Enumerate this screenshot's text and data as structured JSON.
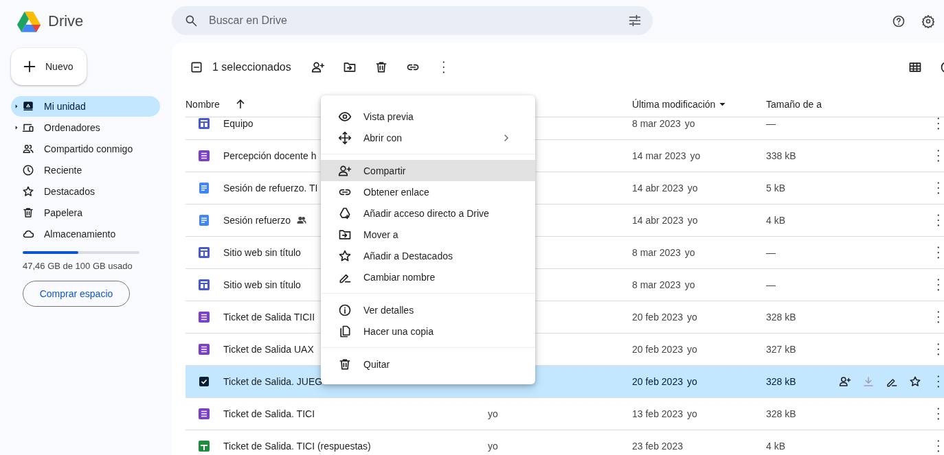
{
  "app": {
    "name": "Drive"
  },
  "search": {
    "placeholder": "Buscar en Drive"
  },
  "new_button": {
    "label": "Nuevo"
  },
  "sidebar": {
    "items": [
      {
        "label": "Mi unidad",
        "selected": true,
        "expandable": true
      },
      {
        "label": "Ordenadores",
        "selected": false,
        "expandable": true
      },
      {
        "label": "Compartido conmigo",
        "selected": false,
        "expandable": false
      },
      {
        "label": "Reciente",
        "selected": false,
        "expandable": false
      },
      {
        "label": "Destacados",
        "selected": false,
        "expandable": false
      },
      {
        "label": "Papelera",
        "selected": false,
        "expandable": false
      },
      {
        "label": "Almacenamiento",
        "selected": false,
        "expandable": false
      }
    ]
  },
  "storage": {
    "level": 0.4746,
    "text": "47,46 GB de 100 GB usado",
    "button": "Comprar espacio"
  },
  "toolbar": {
    "selection": "1 seleccionados"
  },
  "table": {
    "columns": [
      {
        "label": "Nombre",
        "kind": "ascending"
      },
      {
        "label": "Última modificación",
        "kind": "descending"
      },
      {
        "label": "Tamaño de a",
        "kind": "plain"
      }
    ],
    "rows": [
      {
        "kind": "site",
        "name": "Equipo",
        "shared": false,
        "modified": "8 mar 2023",
        "modified_by": "yo",
        "size": "—",
        "selected": false
      },
      {
        "kind": "form",
        "name": "Percepción docente h",
        "modified": "14 mar 2023",
        "modified_by": "yo",
        "size": "338 kB",
        "selected": false
      },
      {
        "kind": "doc",
        "name": "Sesión de refuerzo. TI",
        "modified": "14 abr 2023",
        "modified_by": "yo",
        "size": "5 kB",
        "selected": false
      },
      {
        "kind": "doc",
        "name": "Sesión refuerzo",
        "shared": true,
        "modified": "14 abr 2023",
        "modified_by": "yo",
        "size": "4 kB",
        "selected": false
      },
      {
        "kind": "site",
        "name": "Sitio web sin título",
        "shared": false,
        "modified": "8 mar 2023",
        "modified_by": "yo",
        "size": "—",
        "selected": false
      },
      {
        "kind": "site",
        "name": "Sitio web sin título",
        "shared": false,
        "modified": "8 mar 2023",
        "modified_by": "yo",
        "size": "—",
        "selected": false
      },
      {
        "kind": "form",
        "name": "Ticket de Salida TICII",
        "modified": "20 feb 2023",
        "modified_by": "yo",
        "size": "328 kB",
        "selected": false
      },
      {
        "kind": "form",
        "name": "Ticket de Salida UAX",
        "shared": false,
        "modified": "20 feb 2023",
        "modified_by": "yo",
        "size": "327 kB",
        "selected": false
      },
      {
        "name": "Ticket de Salida. JUEG",
        "modified": "20 feb 2023",
        "modified_by": "yo",
        "size": "328 kB",
        "selected": true
      },
      {
        "kind": "form",
        "name": "Ticket de Salida. TICI",
        "shared": false,
        "owner": "yo",
        "modified": "13 feb 2023",
        "modified_by": "yo",
        "size": "328 kB",
        "selected": false
      },
      {
        "kind": "sheet",
        "name": "Ticket de Salida. TICI (respuestas)",
        "shared": false,
        "owner": "yo",
        "modified": "23 feb 2023",
        "size": "4 kB",
        "selected": false
      }
    ]
  },
  "context_menu": {
    "groups": [
      [
        {
          "label": "Vista previa",
          "submenu": false,
          "selected": false
        },
        {
          "label": "Abrir con",
          "submenu": true,
          "selected": false
        }
      ],
      [
        {
          "label": "Compartir",
          "submenu": false,
          "selected": true
        },
        {
          "label": "Obtener enlace",
          "submenu": false,
          "selected": false
        },
        {
          "label": "Añadir acceso directo a Drive",
          "submenu": false,
          "selected": false
        },
        {
          "label": "Mover a",
          "submenu": false,
          "selected": false
        },
        {
          "label": "Añadir a Destacados",
          "submenu": false,
          "selected": false
        },
        {
          "label": "Cambiar nombre",
          "submenu": false,
          "selected": false
        }
      ],
      [
        {
          "label": "Ver detalles",
          "submenu": false,
          "selected": false
        },
        {
          "label": "Hacer una copia",
          "submenu": false,
          "selected": false
        }
      ],
      [
        {
          "label": "Quitar",
          "submenu": false,
          "selected": false
        }
      ]
    ]
  }
}
